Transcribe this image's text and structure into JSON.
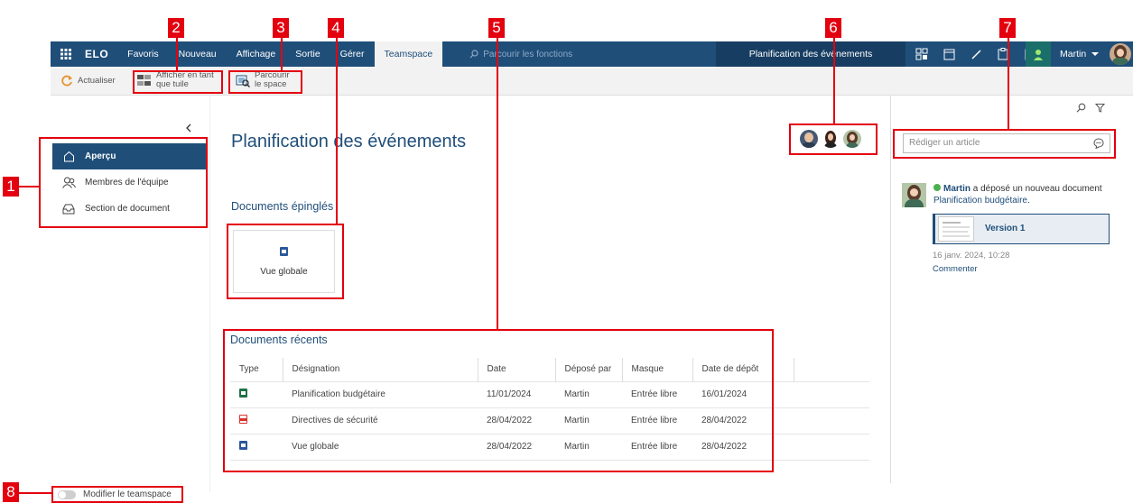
{
  "callouts": [
    "1",
    "2",
    "3",
    "4",
    "5",
    "6",
    "7",
    "8"
  ],
  "nav": {
    "logo": "ELO",
    "items": [
      "Favoris",
      "Nouveau",
      "Affichage",
      "Sortie",
      "Gérer",
      "Teamspace"
    ],
    "search_placeholder": "Parcourir les fonctions",
    "context_title": "Planification des événements",
    "user": "Martin"
  },
  "ribbon": {
    "refresh": "Actualiser",
    "tile_view_line1": "Afficher en tant",
    "tile_view_line2": "que tuile",
    "browse_line1": "Parcourir",
    "browse_line2": "le space"
  },
  "sidebar": {
    "items": [
      {
        "label": "Aperçu",
        "icon": "home-icon"
      },
      {
        "label": "Membres de l'équipe",
        "icon": "team-icon"
      },
      {
        "label": "Section de document",
        "icon": "inbox-icon"
      }
    ],
    "toggle_label": "Modifier le teamspace"
  },
  "main": {
    "title": "Planification des événements",
    "pinned_heading": "Documents épinglés",
    "pinned_tile": "Vue globale",
    "recent_heading": "Documents récents",
    "columns": [
      "Type",
      "Désignation",
      "Date",
      "Déposé par",
      "Masque",
      "Date de dépôt"
    ],
    "rows": [
      {
        "type": "excel",
        "name": "Planification budgétaire",
        "date": "11/01/2024",
        "by": "Martin",
        "mask": "Entrée libre",
        "filed": "16/01/2024"
      },
      {
        "type": "pdf",
        "name": "Directives de sécurité",
        "date": "28/04/2022",
        "by": "Martin",
        "mask": "Entrée libre",
        "filed": "28/04/2022"
      },
      {
        "type": "word",
        "name": "Vue globale",
        "date": "28/04/2022",
        "by": "Martin",
        "mask": "Entrée libre",
        "filed": "28/04/2022"
      }
    ]
  },
  "feed": {
    "input_placeholder": "Rédiger un article",
    "author": "Martin",
    "action": " a déposé un nouveau document",
    "doc_link": "Planification budgétaire",
    "doc_suffix": ".",
    "version": "Version 1",
    "timestamp": "16 janv. 2024, 10:28",
    "comment": "Commenter"
  },
  "colors": {
    "brand": "#1f4e79",
    "callout": "#e3000f",
    "online": "#4caf50"
  }
}
